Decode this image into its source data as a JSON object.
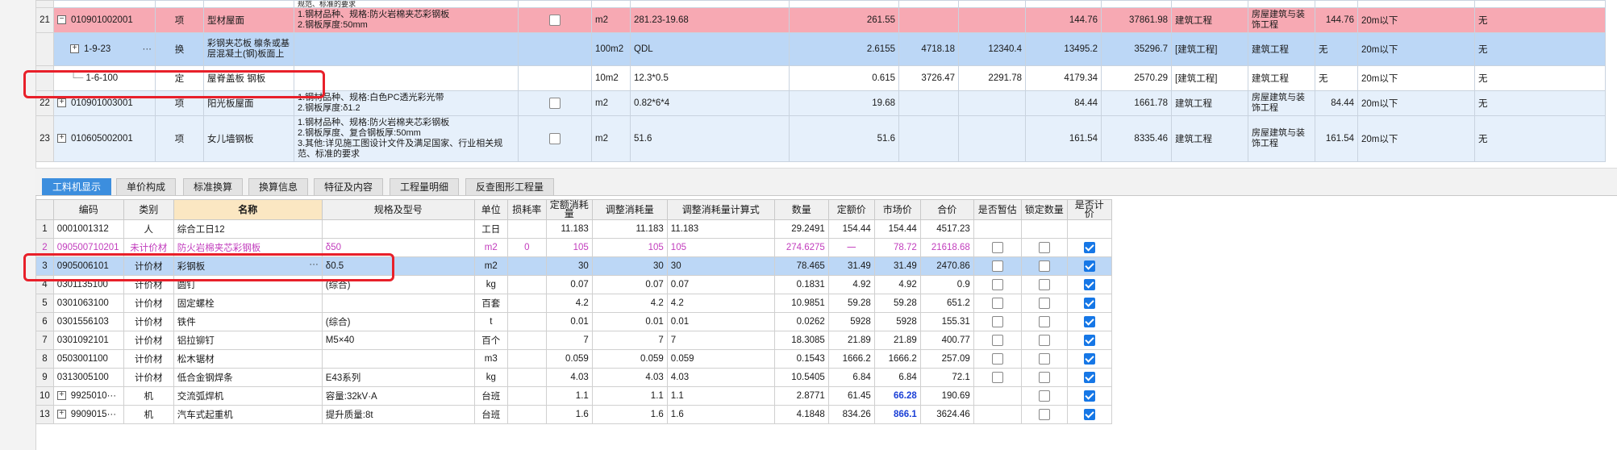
{
  "top_rows": {
    "cut_text": "规范、标准的要求",
    "r21": {
      "no": "21",
      "code": "010901002001",
      "type": "项",
      "name": "型材屋面",
      "desc": "1.钢材品种、规格:防火岩棉夹芯彩钢板\n2.钢板厚度:50mm",
      "unit": "m2",
      "expr": "281.23-19.68",
      "qty": "261.55",
      "p1": "",
      "p2": "",
      "p3": "144.76",
      "total": "37861.98",
      "cat": "建筑工程",
      "cat2": "房屋建筑与装饰工程",
      "price2": "144.76",
      "t1": "",
      "height": "20m以下",
      "last": "无"
    },
    "r_sel": {
      "code": "1-9-23",
      "type": "换",
      "name": "彩钢夹芯板 檩条或基层混凝土(钢)板面上",
      "unit": "100m2",
      "expr": "QDL",
      "qty": "2.6155",
      "p1": "4718.18",
      "p2": "12340.4",
      "p3": "13495.2",
      "total": "35296.7",
      "cat": "[建筑工程]",
      "cat2": "建筑工程",
      "price2": "",
      "t1": "无",
      "height": "20m以下",
      "last": "无"
    },
    "r_def": {
      "code": "1-6-100",
      "type": "定",
      "name": "屋脊盖板 钢板",
      "unit": "10m2",
      "expr": "12.3*0.5",
      "qty": "0.615",
      "p1": "3726.47",
      "p2": "2291.78",
      "p3": "4179.34",
      "total": "2570.29",
      "cat": "[建筑工程]",
      "cat2": "建筑工程",
      "price2": "",
      "t1": "无",
      "height": "20m以下",
      "last": "无"
    },
    "r22": {
      "no": "22",
      "code": "010901003001",
      "type": "项",
      "name": "阳光板屋面",
      "desc": "1.钢材品种、规格:白色PC透光彩光带\n2.钢板厚度:δ1.2",
      "unit": "m2",
      "expr": "0.82*6*4",
      "qty": "19.68",
      "p1": "",
      "p2": "",
      "p3": "84.44",
      "total": "1661.78",
      "cat": "建筑工程",
      "cat2": "房屋建筑与装饰工程",
      "price2": "84.44",
      "t1": "",
      "height": "20m以下",
      "last": "无"
    },
    "r23": {
      "no": "23",
      "code": "010605002001",
      "type": "项",
      "name": "女儿墙钢板",
      "desc": "1.钢材品种、规格:防火岩棉夹芯彩钢板\n2.钢板厚度、复合钢板厚:50mm\n3.其他:详见施工图设计文件及满足国家、行业相关规范、标准的要求",
      "unit": "m2",
      "expr": "51.6",
      "qty": "51.6",
      "p1": "",
      "p2": "",
      "p3": "161.54",
      "total": "8335.46",
      "cat": "建筑工程",
      "cat2": "房屋建筑与装饰工程",
      "price2": "161.54",
      "t1": "",
      "height": "20m以下",
      "last": "无"
    }
  },
  "tabs": [
    "工料机显示",
    "单价构成",
    "标准换算",
    "换算信息",
    "特征及内容",
    "工程量明细",
    "反查图形工程量"
  ],
  "bottom": {
    "headers": [
      "编码",
      "类别",
      "名称",
      "规格及型号",
      "单位",
      "损耗率",
      "定额消耗量",
      "调整消耗量",
      "调整消耗量计算式",
      "数量",
      "定额价",
      "市场价",
      "合价",
      "是否暂估",
      "锁定数量",
      "是否计价"
    ],
    "rows": [
      {
        "no": "1",
        "code": "0001001312",
        "cat": "人",
        "name": "综合工日12",
        "spec": "",
        "unit": "工日",
        "loss": "",
        "dq": "11.183",
        "aq": "11.183",
        "af": "11.183",
        "qty": "29.2491",
        "dp": "154.44",
        "mp": "154.44",
        "total": "4517.23",
        "est": null,
        "lock": null,
        "price": null
      },
      {
        "no": "2",
        "code": "090500710201",
        "cat": "未计价材",
        "name": "防火岩棉夹芯彩钢板",
        "spec": "δ50",
        "unit": "m2",
        "loss": "0",
        "dq": "105",
        "aq": "105",
        "af": "105",
        "qty": "274.6275",
        "dp": "一",
        "mp": "78.72",
        "total": "21618.68",
        "est": false,
        "lock": false,
        "price": true
      },
      {
        "no": "3",
        "code": "0905006101",
        "cat": "计价材",
        "name": "彩钢板",
        "spec": "δ0.5",
        "unit": "m2",
        "loss": "",
        "dq": "30",
        "aq": "30",
        "af": "30",
        "qty": "78.465",
        "dp": "31.49",
        "mp": "31.49",
        "total": "2470.86",
        "est": false,
        "lock": false,
        "price": true
      },
      {
        "no": "4",
        "code": "0301135100",
        "cat": "计价材",
        "name": "圆钉",
        "spec": "(综合)",
        "unit": "kg",
        "loss": "",
        "dq": "0.07",
        "aq": "0.07",
        "af": "0.07",
        "qty": "0.1831",
        "dp": "4.92",
        "mp": "4.92",
        "total": "0.9",
        "est": false,
        "lock": false,
        "price": true
      },
      {
        "no": "5",
        "code": "0301063100",
        "cat": "计价材",
        "name": "固定螺栓",
        "spec": "",
        "unit": "百套",
        "loss": "",
        "dq": "4.2",
        "aq": "4.2",
        "af": "4.2",
        "qty": "10.9851",
        "dp": "59.28",
        "mp": "59.28",
        "total": "651.2",
        "est": false,
        "lock": false,
        "price": true
      },
      {
        "no": "6",
        "code": "0301556103",
        "cat": "计价材",
        "name": "铁件",
        "spec": "(综合)",
        "unit": "t",
        "loss": "",
        "dq": "0.01",
        "aq": "0.01",
        "af": "0.01",
        "qty": "0.0262",
        "dp": "5928",
        "mp": "5928",
        "total": "155.31",
        "est": false,
        "lock": false,
        "price": true
      },
      {
        "no": "7",
        "code": "0301092101",
        "cat": "计价材",
        "name": "铝拉铆钉",
        "spec": "M5×40",
        "unit": "百个",
        "loss": "",
        "dq": "7",
        "aq": "7",
        "af": "7",
        "qty": "18.3085",
        "dp": "21.89",
        "mp": "21.89",
        "total": "400.77",
        "est": false,
        "lock": false,
        "price": true
      },
      {
        "no": "8",
        "code": "0503001100",
        "cat": "计价材",
        "name": "松木锯材",
        "spec": "",
        "unit": "m3",
        "loss": "",
        "dq": "0.059",
        "aq": "0.059",
        "af": "0.059",
        "qty": "0.1543",
        "dp": "1666.2",
        "mp": "1666.2",
        "total": "257.09",
        "est": false,
        "lock": false,
        "price": true
      },
      {
        "no": "9",
        "code": "0313005100",
        "cat": "计价材",
        "name": "低合金钢焊条",
        "spec": "E43系列",
        "unit": "kg",
        "loss": "",
        "dq": "4.03",
        "aq": "4.03",
        "af": "4.03",
        "qty": "10.5405",
        "dp": "6.84",
        "mp": "6.84",
        "total": "72.1",
        "est": false,
        "lock": false,
        "price": true
      },
      {
        "no": "10",
        "code": "9925010···",
        "cat": "机",
        "name": "交流弧焊机",
        "spec": "容量:32kV·A",
        "unit": "台班",
        "loss": "",
        "dq": "1.1",
        "aq": "1.1",
        "af": "1.1",
        "qty": "2.8771",
        "dp": "61.45",
        "mp": "66.28",
        "total": "190.69",
        "est": null,
        "lock": false,
        "price": true,
        "mp_bold": true,
        "expand": true
      },
      {
        "no": "13",
        "code": "9909015···",
        "cat": "机",
        "name": "汽车式起重机",
        "spec": "提升质量:8t",
        "unit": "台班",
        "loss": "",
        "dq": "1.6",
        "aq": "1.6",
        "af": "1.6",
        "qty": "4.1848",
        "dp": "834.26",
        "mp": "866.1",
        "total": "3624.46",
        "est": null,
        "lock": false,
        "price": true,
        "mp_bold": true,
        "expand": true
      }
    ]
  },
  "colors": {
    "highlight_box": "#e8202a",
    "active_tab": "#3c8ede",
    "selected_row": "#bcd7f6",
    "pink_row": "#f7a9b3",
    "unpriced_text": "#c23dbd",
    "market_price_bold": "#1a3fd6"
  }
}
